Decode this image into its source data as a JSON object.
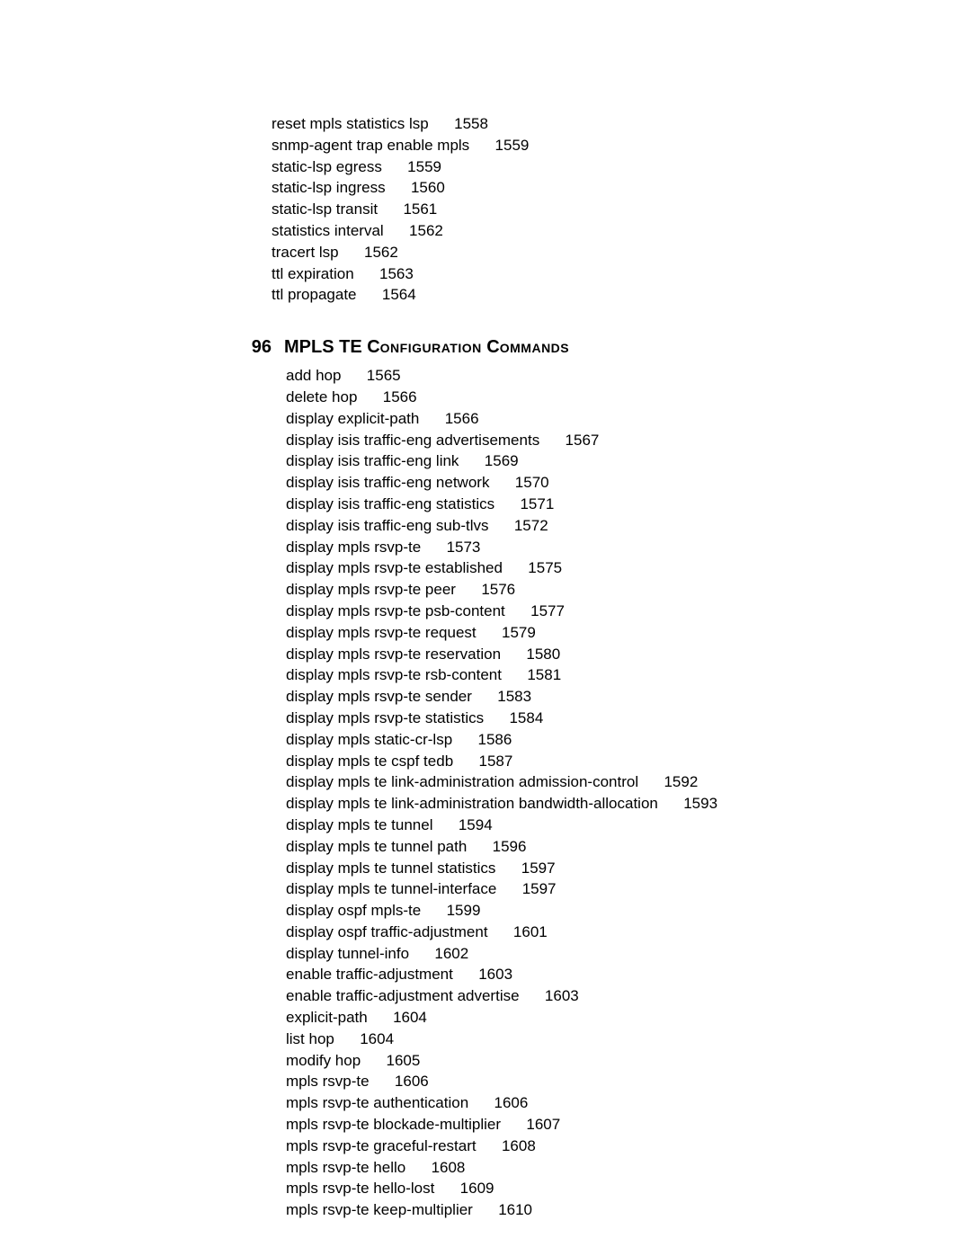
{
  "pre_entries": [
    {
      "label": "reset mpls statistics lsp",
      "page": "1558"
    },
    {
      "label": "snmp-agent trap enable mpls",
      "page": "1559"
    },
    {
      "label": "static-lsp egress",
      "page": "1559"
    },
    {
      "label": "static-lsp ingress",
      "page": "1560"
    },
    {
      "label": "static-lsp transit",
      "page": "1561"
    },
    {
      "label": "statistics interval",
      "page": "1562"
    },
    {
      "label": "tracert lsp",
      "page": "1562"
    },
    {
      "label": "ttl expiration",
      "page": "1563"
    },
    {
      "label": "ttl propagate",
      "page": "1564"
    }
  ],
  "chapter": {
    "number": "96",
    "title_prefix": "MPLS TE C",
    "title_mid1": "onfiguration",
    "title_space": " C",
    "title_mid2": "ommands"
  },
  "chapter_entries": [
    {
      "label": "add hop",
      "page": "1565"
    },
    {
      "label": "delete hop",
      "page": "1566"
    },
    {
      "label": "display explicit-path",
      "page": "1566"
    },
    {
      "label": "display isis traffic-eng advertisements",
      "page": "1567"
    },
    {
      "label": "display isis traffic-eng link",
      "page": "1569"
    },
    {
      "label": "display isis traffic-eng network",
      "page": "1570"
    },
    {
      "label": "display isis traffic-eng statistics",
      "page": "1571"
    },
    {
      "label": "display isis traffic-eng sub-tlvs",
      "page": "1572"
    },
    {
      "label": "display mpls rsvp-te",
      "page": "1573"
    },
    {
      "label": "display mpls rsvp-te established",
      "page": "1575"
    },
    {
      "label": "display mpls rsvp-te peer",
      "page": "1576"
    },
    {
      "label": "display mpls rsvp-te psb-content",
      "page": "1577"
    },
    {
      "label": "display mpls rsvp-te request",
      "page": "1579"
    },
    {
      "label": "display mpls rsvp-te reservation",
      "page": "1580"
    },
    {
      "label": "display mpls rsvp-te rsb-content",
      "page": "1581"
    },
    {
      "label": "display mpls rsvp-te sender",
      "page": "1583"
    },
    {
      "label": "display mpls rsvp-te statistics",
      "page": "1584"
    },
    {
      "label": "display mpls static-cr-lsp",
      "page": "1586"
    },
    {
      "label": "display mpls te cspf tedb",
      "page": "1587"
    },
    {
      "label": "display mpls te link-administration admission-control",
      "page": "1592"
    },
    {
      "label": "display mpls te link-administration bandwidth-allocation",
      "page": "1593"
    },
    {
      "label": "display mpls te tunnel",
      "page": "1594"
    },
    {
      "label": "display mpls te tunnel path",
      "page": "1596"
    },
    {
      "label": "display mpls te tunnel statistics",
      "page": "1597"
    },
    {
      "label": "display mpls te tunnel-interface",
      "page": "1597"
    },
    {
      "label": "display ospf mpls-te",
      "page": "1599"
    },
    {
      "label": "display ospf traffic-adjustment",
      "page": "1601"
    },
    {
      "label": "display tunnel-info",
      "page": "1602"
    },
    {
      "label": "enable traffic-adjustment",
      "page": "1603"
    },
    {
      "label": "enable traffic-adjustment advertise",
      "page": "1603"
    },
    {
      "label": "explicit-path",
      "page": "1604"
    },
    {
      "label": "list hop",
      "page": "1604"
    },
    {
      "label": "modify hop",
      "page": "1605"
    },
    {
      "label": "mpls rsvp-te",
      "page": "1606"
    },
    {
      "label": "mpls rsvp-te authentication",
      "page": "1606"
    },
    {
      "label": "mpls rsvp-te blockade-multiplier",
      "page": "1607"
    },
    {
      "label": "mpls rsvp-te graceful-restart",
      "page": "1608"
    },
    {
      "label": "mpls rsvp-te hello",
      "page": "1608"
    },
    {
      "label": "mpls rsvp-te hello-lost",
      "page": "1609"
    },
    {
      "label": "mpls rsvp-te keep-multiplier",
      "page": "1610"
    }
  ],
  "gap": "      "
}
